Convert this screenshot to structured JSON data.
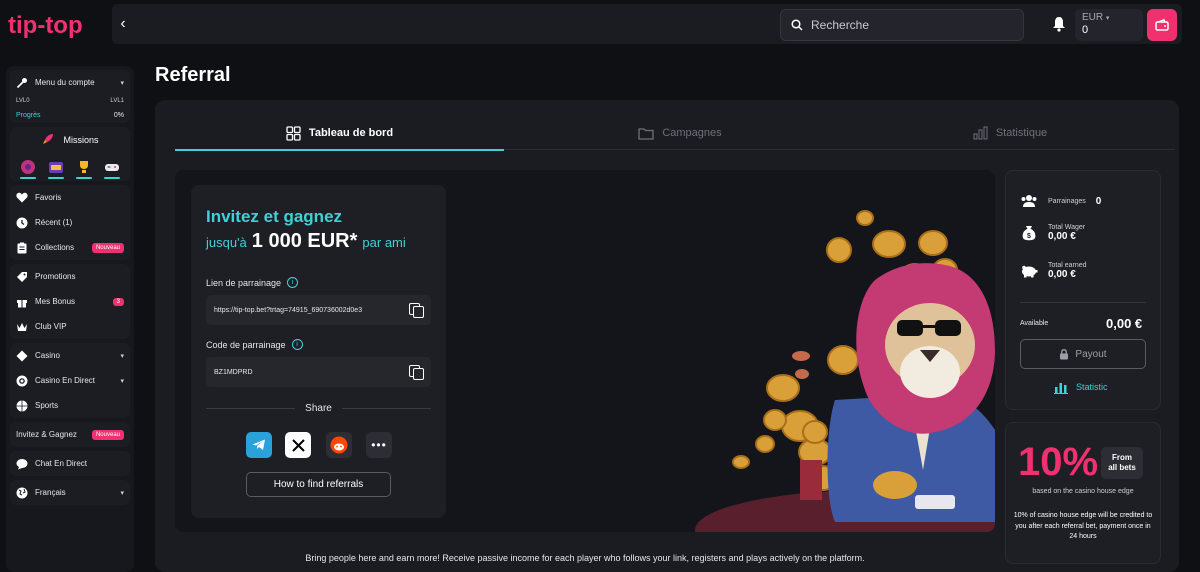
{
  "header": {
    "logo_text": "tip-top",
    "search_placeholder": "Recherche",
    "currency": "EUR",
    "balance": "0"
  },
  "sidebar": {
    "account_menu": "Menu du compte",
    "lvl_start": "LVL0",
    "lvl_end": "LVL1",
    "progress_label": "Progrès",
    "progress_value": "0%",
    "missions": "Missions",
    "favorites": "Favoris",
    "recent": "Récent (1)",
    "collections": "Collections",
    "new_badge": "Nouveau",
    "promotions": "Promotions",
    "bonuses": "Mes Bonus",
    "bonus_count": "3",
    "vip": "Club VIP",
    "casino": "Casino",
    "live_casino": "Casino En Direct",
    "sports": "Sports",
    "invite": "Invitez & Gagnez",
    "live_chat": "Chat En Direct",
    "language": "Français"
  },
  "page": {
    "title": "Referral"
  },
  "tabs": [
    {
      "label": "Tableau de bord",
      "active": true
    },
    {
      "label": "Campagnes",
      "active": false
    },
    {
      "label": "Statistique",
      "active": false
    }
  ],
  "invite": {
    "title": "Invitez et gagnez",
    "sub_prefix": "jusqu'à",
    "amount": "1 000 EUR*",
    "sub_suffix": "par ami",
    "link_label": "Lien de parrainage",
    "link_value": "https://tip-top.bet?trtag=74915_690736002d0e3",
    "code_label": "Code de parrainage",
    "code_value": "BZ1MDPRD",
    "share_label": "Share",
    "find_button": "How to find referrals"
  },
  "bottom_text": "Bring people here and earn more! Receive passive income for each player who follows your link, registers and plays actively on the platform.",
  "stats": {
    "referrals_label": "Parrainages",
    "referrals_value": "0",
    "wager_label": "Total Wager",
    "wager_value": "0,00 €",
    "earned_label": "Total earned",
    "earned_value": "0,00 €",
    "available_label": "Available",
    "available_value": "0,00 €",
    "payout_button": "Payout",
    "statistic_link": "Statistic"
  },
  "promo": {
    "percent": "10%",
    "from_line1": "From",
    "from_line2": "all bets",
    "subtitle": "based on the casino house edge",
    "description": "10% of casino house edge will be credited to you after each referral bet, payment once in 24 hours"
  },
  "colors": {
    "accent": "#3fd1d5",
    "brand": "#f0306f",
    "background": "#0f1014",
    "panel": "#1b1c21"
  }
}
